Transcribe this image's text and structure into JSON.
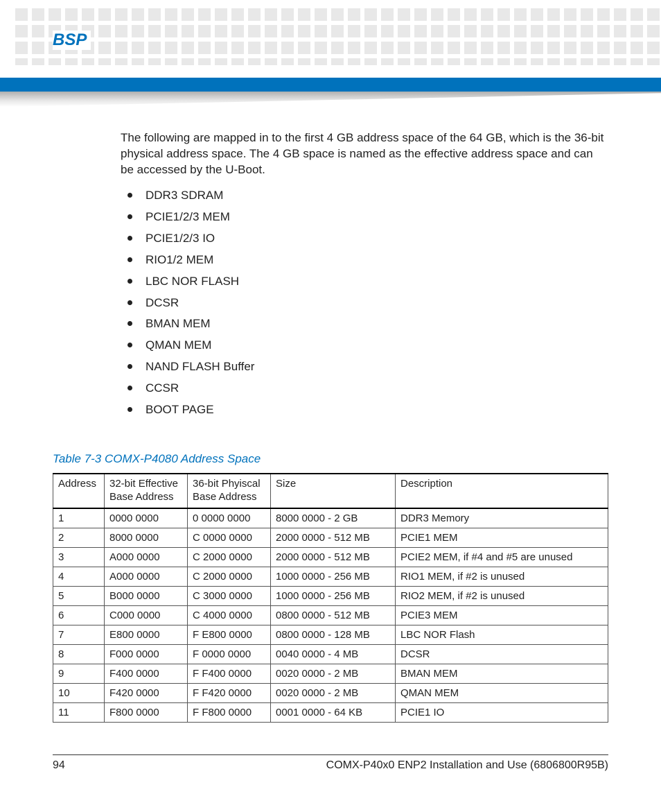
{
  "header": {
    "section_title": "BSP"
  },
  "body": {
    "intro": "The following are mapped in to the first 4 GB address space of the 64 GB, which is the 36-bit physical address space. The 4 GB space is named as the effective address space and can be accessed by the U-Boot.",
    "bullets": [
      "DDR3 SDRAM",
      "PCIE1/2/3 MEM",
      "PCIE1/2/3 IO",
      "RIO1/2 MEM",
      "LBC NOR FLASH",
      "DCSR",
      "BMAN MEM",
      "QMAN MEM",
      "NAND FLASH Buffer",
      "CCSR",
      "BOOT PAGE"
    ]
  },
  "table": {
    "caption": "Table 7-3 COMX-P4080 Address Space",
    "headers": {
      "c1": "Address",
      "c2": "32-bit Effective Base Address",
      "c3": "36-bit Phyiscal Base Address",
      "c4": "Size",
      "c5": "Description"
    },
    "rows": [
      {
        "c1": "1",
        "c2": "0000 0000",
        "c3": "0 0000 0000",
        "c4": "8000 0000 - 2 GB",
        "c5": "DDR3 Memory"
      },
      {
        "c1": "2",
        "c2": "8000 0000",
        "c3": "C 0000 0000",
        "c4": "2000 0000 - 512 MB",
        "c5": "PCIE1 MEM"
      },
      {
        "c1": "3",
        "c2": "A000 0000",
        "c3": "C 2000 0000",
        "c4": "2000 0000 - 512 MB",
        "c5": "PCIE2 MEM, if #4 and #5 are unused"
      },
      {
        "c1": "4",
        "c2": "A000 0000",
        "c3": "C 2000 0000",
        "c4": "1000 0000 - 256 MB",
        "c5": "RIO1 MEM, if #2 is unused"
      },
      {
        "c1": "5",
        "c2": "B000 0000",
        "c3": "C 3000 0000",
        "c4": "1000 0000 - 256 MB",
        "c5": "RIO2 MEM, if #2 is unused"
      },
      {
        "c1": "6",
        "c2": "C000 0000",
        "c3": "C 4000 0000",
        "c4": "0800 0000 - 512 MB",
        "c5": "PCIE3 MEM"
      },
      {
        "c1": "7",
        "c2": "E800 0000",
        "c3": "F E800 0000",
        "c4": "0800 0000 - 128 MB",
        "c5": "LBC NOR Flash"
      },
      {
        "c1": "8",
        "c2": "F000 0000",
        "c3": "F 0000 0000",
        "c4": "0040 0000 - 4 MB",
        "c5": "DCSR"
      },
      {
        "c1": "9",
        "c2": "F400 0000",
        "c3": "F F400 0000",
        "c4": "0020 0000 - 2 MB",
        "c5": "BMAN MEM"
      },
      {
        "c1": "10",
        "c2": "F420 0000",
        "c3": "F F420 0000",
        "c4": "0020 0000 - 2 MB",
        "c5": "QMAN MEM"
      },
      {
        "c1": "11",
        "c2": "F800 0000",
        "c3": "F F800 0000",
        "c4": "0001 0000 - 64 KB",
        "c5": "PCIE1 IO"
      }
    ]
  },
  "footer": {
    "page_number": "94",
    "doc_title": "COMX-P40x0 ENP2 Installation and Use (6806800R95B)"
  }
}
